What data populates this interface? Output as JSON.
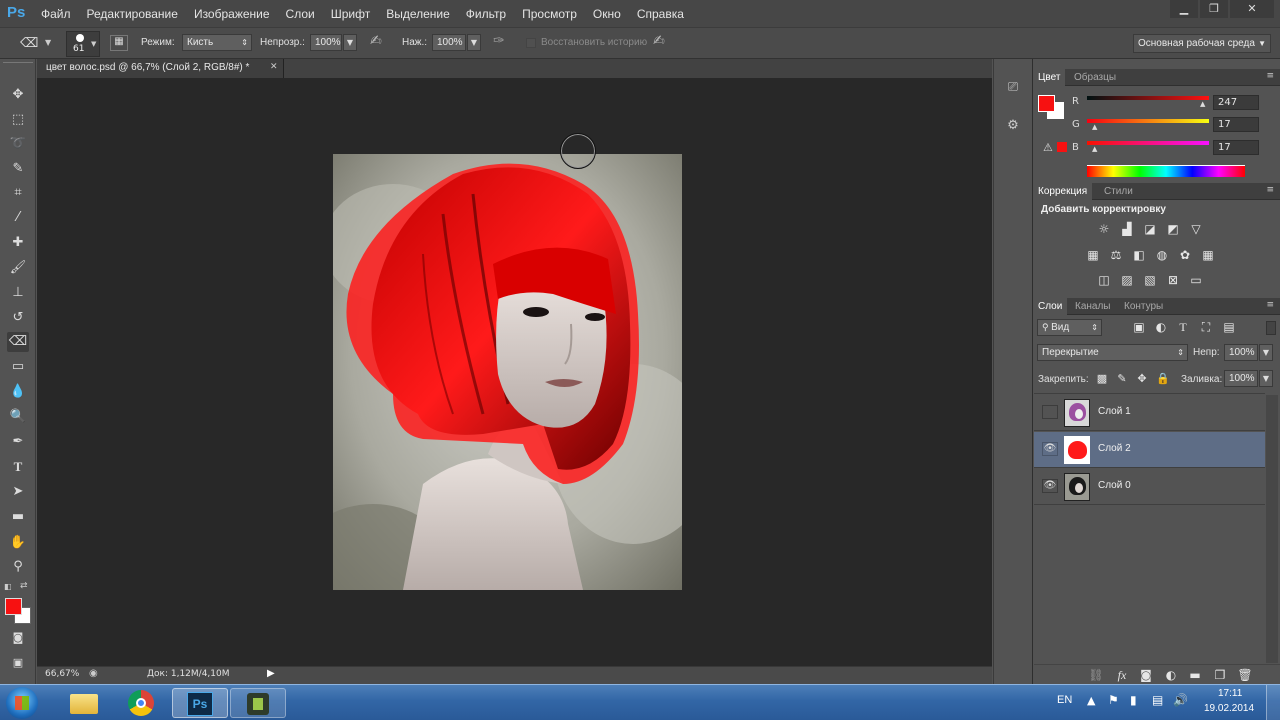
{
  "app": {
    "logo": "Ps"
  },
  "menu": [
    "Файл",
    "Редактирование",
    "Изображение",
    "Слои",
    "Шрифт",
    "Выделение",
    "Фильтр",
    "Просмотр",
    "Окно",
    "Справка"
  ],
  "window_controls": [
    "minimize-icon",
    "restore-icon",
    "close-icon"
  ],
  "options": {
    "brush_size": "61",
    "mode_label": "Режим:",
    "mode_value": "Кисть",
    "opacity_label": "Непрозр.:",
    "opacity_value": "100%",
    "flow_label": "Наж.:",
    "flow_value": "100%",
    "history_label": "Восстановить историю",
    "workspace": "Основная рабочая среда"
  },
  "document": {
    "tab_title": "цвет волос.psd @ 66,7% (Слой 2, RGB/8#) *",
    "zoom": "66,67%",
    "doc_size": "Док: 1,12M/4,10M"
  },
  "color_panel": {
    "tabs": [
      "Цвет",
      "Образцы"
    ],
    "r_label": "R",
    "g_label": "G",
    "b_label": "B",
    "r": "247",
    "g": "17",
    "b": "17",
    "foreground": "#f71111",
    "background": "#ffffff"
  },
  "adjustments_panel": {
    "tabs": [
      "Коррекция",
      "Стили"
    ],
    "heading": "Добавить корректировку",
    "icons": [
      [
        "brightness-icon",
        "levels-icon",
        "curves-icon",
        "exposure-icon",
        "vibrance-icon"
      ],
      [
        "hue-saturation-icon",
        "color-balance-icon",
        "black-white-icon",
        "photo-filter-icon",
        "channel-mixer-icon",
        "color-lookup-icon"
      ],
      [
        "invert-icon",
        "posterize-icon",
        "threshold-icon",
        "selective-color-icon",
        "gradient-map-icon"
      ]
    ]
  },
  "layers_panel": {
    "tabs": [
      "Слои",
      "Каналы",
      "Контуры"
    ],
    "filter_label": "Вид",
    "blend_mode": "Перекрытие",
    "opacity_label": "Непр:",
    "opacity_value": "100%",
    "lock_label": "Закрепить:",
    "fill_label": "Заливка:",
    "fill_value": "100%",
    "layers": [
      {
        "name": "Слой 1",
        "visible": false,
        "selected": false
      },
      {
        "name": "Слой 2",
        "visible": true,
        "selected": true
      },
      {
        "name": "Слой 0",
        "visible": true,
        "selected": false
      }
    ]
  },
  "taskbar": {
    "apps": [
      "windows-start-icon",
      "explorer-icon",
      "chrome-icon",
      "photoshop-icon",
      "camtasia-icon"
    ],
    "lang": "EN",
    "time": "17:11",
    "date": "19.02.2014"
  }
}
